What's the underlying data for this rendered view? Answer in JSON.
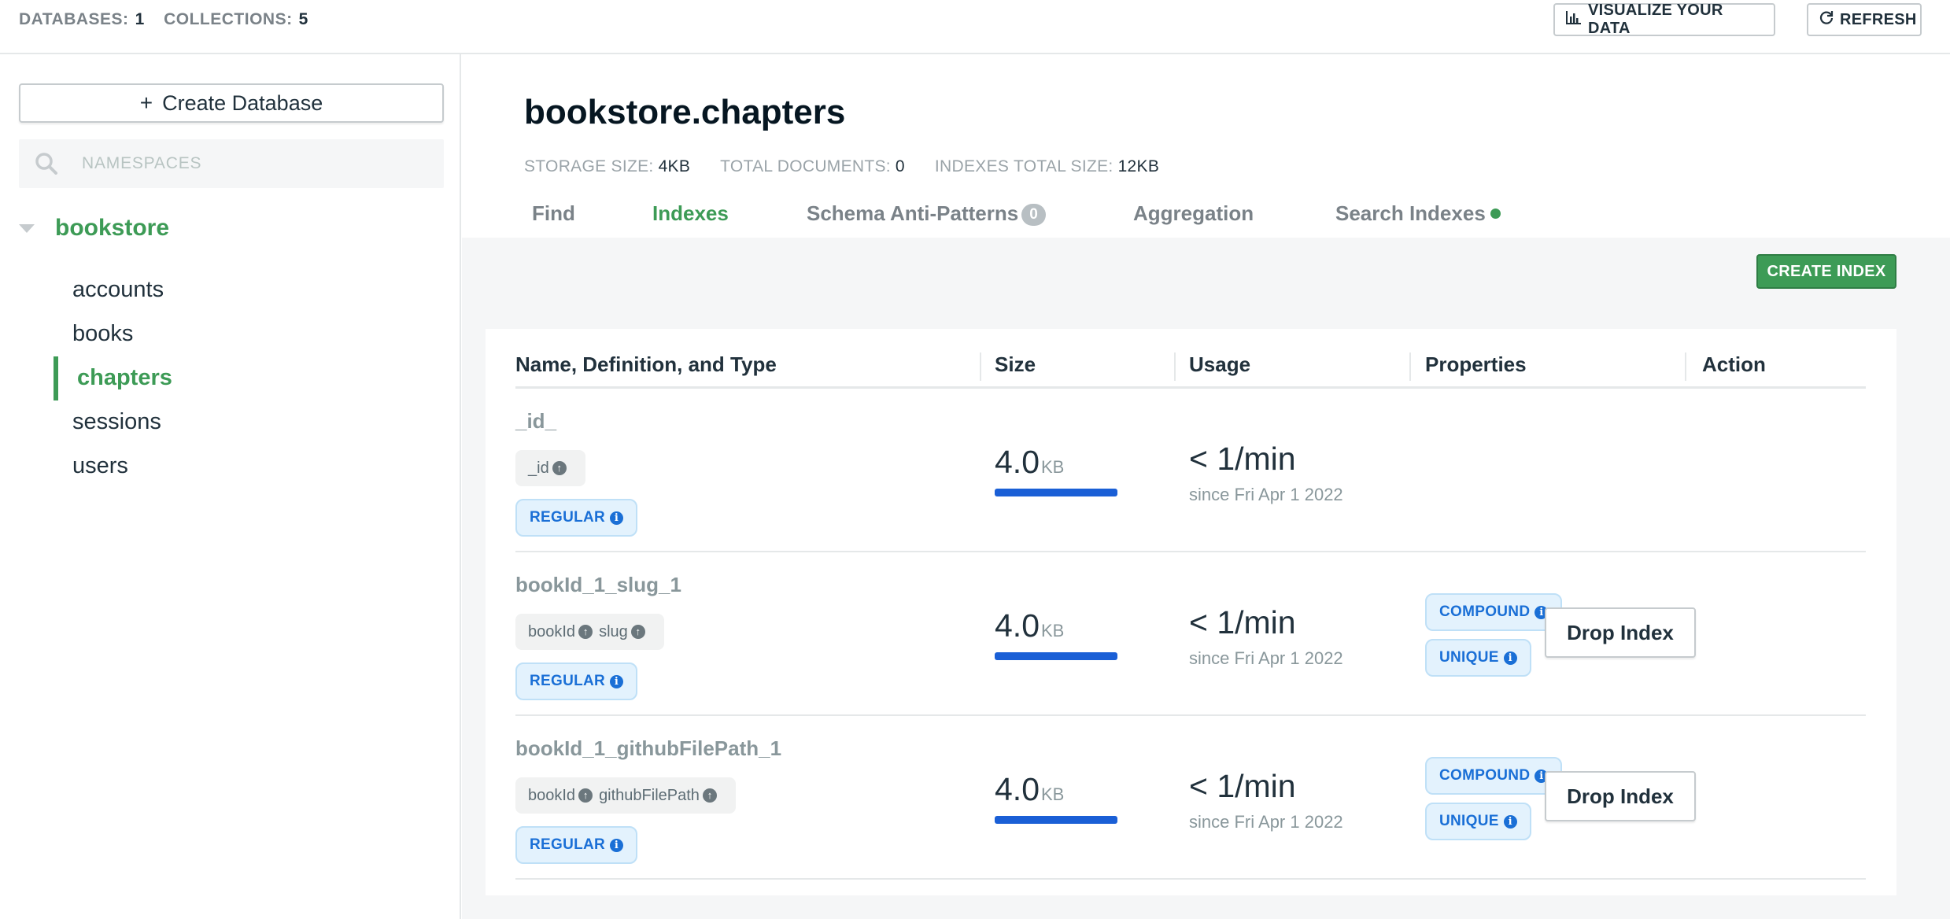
{
  "topbar": {
    "databases_label": "DATABASES:",
    "databases_value": "1",
    "collections_label": "COLLECTIONS:",
    "collections_value": "5",
    "visualize_label": "VISUALIZE YOUR DATA",
    "refresh_label": "REFRESH"
  },
  "sidebar": {
    "create_db_label": "Create Database",
    "search_placeholder": "NAMESPACES",
    "database": "bookstore",
    "collections": [
      "accounts",
      "books",
      "chapters",
      "sessions",
      "users"
    ],
    "active_collection": "chapters"
  },
  "main": {
    "title": "bookstore.chapters",
    "storage_label": "STORAGE SIZE:",
    "storage_value": "4KB",
    "docs_label": "TOTAL DOCUMENTS:",
    "docs_value": "0",
    "indexes_label": "INDEXES TOTAL SIZE:",
    "indexes_value": "12KB",
    "tabs": [
      {
        "label": "Find"
      },
      {
        "label": "Indexes"
      },
      {
        "label": "Schema Anti-Patterns",
        "badge": "0"
      },
      {
        "label": "Aggregation"
      },
      {
        "label": "Search Indexes"
      }
    ],
    "active_tab": "Indexes",
    "accent_color": "#3d9b56",
    "create_index_label": "CREATE INDEX"
  },
  "table": {
    "headers": [
      "Name, Definition, and Type",
      "Size",
      "Usage",
      "Properties",
      "Action"
    ],
    "rows": [
      {
        "name": "_id_",
        "keys": [
          "_id"
        ],
        "type": "REGULAR",
        "size_value": "4.0",
        "size_unit": "KB",
        "usage": "< 1/min",
        "since": "since Fri Apr 1 2022",
        "properties": [],
        "action": ""
      },
      {
        "name": "bookId_1_slug_1",
        "keys": [
          "bookId",
          "slug"
        ],
        "type": "REGULAR",
        "size_value": "4.0",
        "size_unit": "KB",
        "usage": "< 1/min",
        "since": "since Fri Apr 1 2022",
        "properties": [
          "COMPOUND",
          "UNIQUE"
        ],
        "action": "Drop Index"
      },
      {
        "name": "bookId_1_githubFilePath_1",
        "keys": [
          "bookId",
          "githubFilePath"
        ],
        "type": "REGULAR",
        "size_value": "4.0",
        "size_unit": "KB",
        "usage": "< 1/min",
        "since": "since Fri Apr 1 2022",
        "properties": [
          "COMPOUND",
          "UNIQUE"
        ],
        "action": "Drop Index"
      }
    ]
  }
}
